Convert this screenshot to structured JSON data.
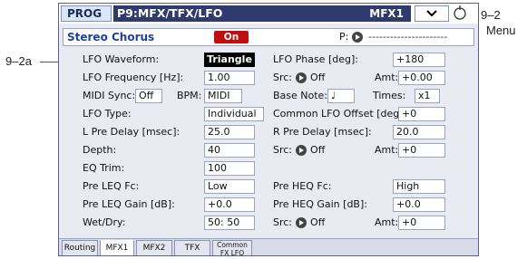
{
  "callouts": {
    "top_right": "9–2",
    "menu": "Menu",
    "left": "9–2a"
  },
  "header": {
    "mode": "PROG",
    "title": "P9:MFX/TFX/LFO",
    "tag": "MFX1"
  },
  "effect": {
    "name": "Stereo Chorus",
    "on_label": "On",
    "p_label": "P:",
    "p_value": "----------------------"
  },
  "params": {
    "lfo_waveform_label": "LFO Waveform:",
    "lfo_waveform_value": "Triangle",
    "lfo_phase_label": "LFO Phase [deg]:",
    "lfo_phase_value": "+180",
    "lfo_freq_label": "LFO Frequency [Hz]:",
    "lfo_freq_value": "1.00",
    "src1_label": "Src:",
    "src1_value": "Off",
    "amt1_label": "Amt:",
    "amt1_value": "+0.00",
    "midi_sync_label": "MIDI Sync:",
    "midi_sync_value": "Off",
    "bpm_label": "BPM:",
    "bpm_value": "MIDI",
    "base_note_label": "Base Note:",
    "base_note_value": "♩",
    "times_label": "Times:",
    "times_value": "x1",
    "lfo_type_label": "LFO Type:",
    "lfo_type_value": "Individual",
    "common_offset_label": "Common LFO Offset [deg]:",
    "common_offset_value": "+0",
    "l_pre_delay_label": "L Pre Delay [msec]:",
    "l_pre_delay_value": "25.0",
    "r_pre_delay_label": "R Pre Delay [msec]:",
    "r_pre_delay_value": "20.0",
    "depth_label": "Depth:",
    "depth_value": "40",
    "src2_label": "Src:",
    "src2_value": "Off",
    "amt2_label": "Amt:",
    "amt2_value": "+0",
    "eq_trim_label": "EQ Trim:",
    "eq_trim_value": "100",
    "pre_leq_fc_label": "Pre LEQ Fc:",
    "pre_leq_fc_value": "Low",
    "pre_heq_fc_label": "Pre HEQ Fc:",
    "pre_heq_fc_value": "High",
    "pre_leq_gain_label": "Pre LEQ Gain [dB]:",
    "pre_leq_gain_value": "+0.0",
    "pre_heq_gain_label": "Pre HEQ Gain [dB]:",
    "pre_heq_gain_value": "+0.0",
    "wet_dry_label": "Wet/Dry:",
    "wet_dry_value": "50: 50",
    "src3_label": "Src:",
    "src3_value": "Off",
    "amt3_label": "Amt:",
    "amt3_value": "+0"
  },
  "tabs": [
    {
      "label": "Routing"
    },
    {
      "label": "MFX1"
    },
    {
      "label": "MFX2"
    },
    {
      "label": "TFX"
    },
    {
      "line1": "Common",
      "line2": "FX LFO"
    }
  ],
  "colors": {
    "title_bar": "#2f3a6e",
    "on_button": "#c10f0f",
    "effect_name": "#1d3fa8",
    "screen_bg": "#e9ebf3"
  }
}
